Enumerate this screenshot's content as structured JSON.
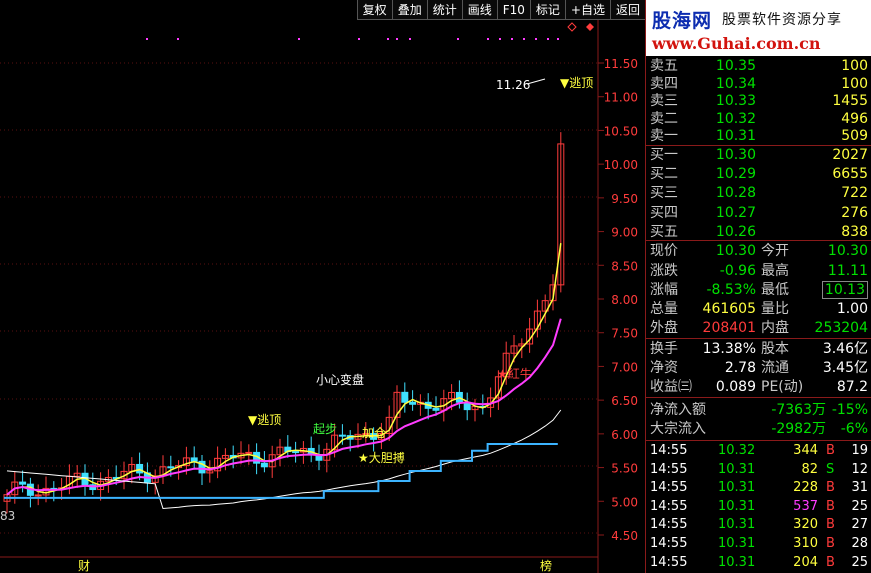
{
  "toolbar": {
    "items": [
      "复权",
      "叠加",
      "统计",
      "画线",
      "F10",
      "标记",
      "+自选",
      "返回"
    ]
  },
  "chart": {
    "price_axis": [
      "11.50",
      "11.00",
      "10.50",
      "10.00",
      "9.50",
      "9.00",
      "8.50",
      "8.00",
      "7.50",
      "7.00",
      "6.50",
      "6.00",
      "5.50",
      "5.00",
      "4.50"
    ],
    "high_marker": "11.26",
    "low_marker": "83",
    "bottom_labels": [
      "财",
      "榜"
    ],
    "signals": {
      "escape_top_1": "▼逃顶",
      "escape_top_2": "▼逃顶",
      "careful_change": "小心变盘",
      "take_off": "起步",
      "add_position": "加仓",
      "bold_bet": "★大胆搏",
      "hold_stock": "★紅牛"
    },
    "colors": {
      "candle_up": "#ff3c3c",
      "candle_down": "#40e0ff",
      "ma_yellow": "#ffff40",
      "ma_magenta": "#ff3cff",
      "ma_white": "#ffffff",
      "ma_blue": "#3cb4ff",
      "axis": "#8a1a1a"
    }
  },
  "logo": {
    "brand": "股海网",
    "tagline": "股票软件资源分享",
    "url": "www.Guhai.com.cn"
  },
  "order_book": {
    "sell": [
      {
        "label": "卖五",
        "price": "10.35",
        "vol": "100"
      },
      {
        "label": "卖四",
        "price": "10.34",
        "vol": "100"
      },
      {
        "label": "卖三",
        "price": "10.33",
        "vol": "1455"
      },
      {
        "label": "卖二",
        "price": "10.32",
        "vol": "496"
      },
      {
        "label": "卖一",
        "price": "10.31",
        "vol": "509"
      }
    ],
    "buy": [
      {
        "label": "买一",
        "price": "10.30",
        "vol": "2027"
      },
      {
        "label": "买二",
        "price": "10.29",
        "vol": "6655"
      },
      {
        "label": "买三",
        "price": "10.28",
        "vol": "722"
      },
      {
        "label": "买四",
        "price": "10.27",
        "vol": "276"
      },
      {
        "label": "买五",
        "price": "10.26",
        "vol": "838"
      }
    ]
  },
  "quote": {
    "current_label": "现价",
    "current": "10.30",
    "open_label": "今开",
    "open": "10.30",
    "change_label": "涨跌",
    "change": "-0.96",
    "high_label": "最高",
    "high": "11.11",
    "pct_label": "涨幅",
    "pct": "-8.53%",
    "low_label": "最低",
    "low": "10.13",
    "volume_label": "总量",
    "volume": "461605",
    "ratio_label": "量比",
    "ratio": "1.00",
    "outer_label": "外盘",
    "outer": "208401",
    "inner_label": "内盘",
    "inner": "253204"
  },
  "fundamentals": {
    "turnover_label": "换手",
    "turnover": "13.38%",
    "equity_label": "股本",
    "equity": "3.46亿",
    "nav_label": "净资",
    "nav": "2.78",
    "float_label": "流通",
    "float": "3.45亿",
    "eps_label": "收益㈢",
    "eps": "0.089",
    "pe_label": "PE(动)",
    "pe": "87.2"
  },
  "flows": {
    "net_label": "净流入额",
    "net": "-7363万",
    "net_pct": "-15%",
    "block_label": "大宗流入",
    "block": "-2982万",
    "block_pct": "-6%"
  },
  "trades": [
    {
      "time": "14:55",
      "price": "10.32",
      "vol": "344",
      "side": "B",
      "count": "19"
    },
    {
      "time": "14:55",
      "price": "10.31",
      "vol": "82",
      "side": "S",
      "count": "12"
    },
    {
      "time": "14:55",
      "price": "10.31",
      "vol": "228",
      "side": "B",
      "count": "31"
    },
    {
      "time": "14:55",
      "price": "10.31",
      "vol": "537",
      "side": "B",
      "count": "25"
    },
    {
      "time": "14:55",
      "price": "10.31",
      "vol": "320",
      "side": "B",
      "count": "27"
    },
    {
      "time": "14:55",
      "price": "10.31",
      "vol": "310",
      "side": "B",
      "count": "28"
    },
    {
      "time": "14:55",
      "price": "10.31",
      "vol": "204",
      "side": "B",
      "count": "25"
    }
  ]
}
